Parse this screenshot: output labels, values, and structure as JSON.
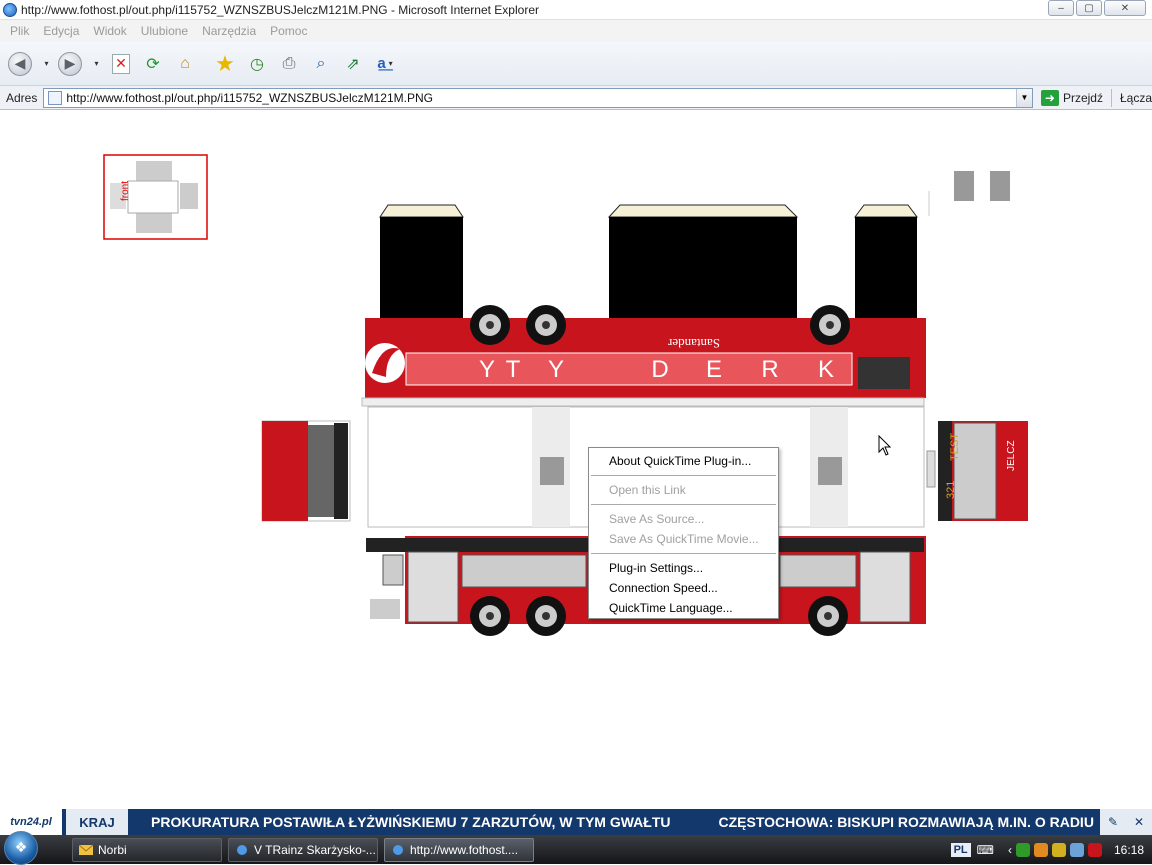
{
  "window": {
    "title": "http://www.fothost.pl/out.php/i115752_WZNSZBUSJelczM121M.PNG - Microsoft Internet Explorer",
    "minimize_label": "‒",
    "maximize_label": "▢",
    "close_label": "✕"
  },
  "menu": {
    "items": [
      "Plik",
      "Edycja",
      "Widok",
      "Ulubione",
      "Narzędzia",
      "Pomoc"
    ]
  },
  "toolbar": {
    "back_glyph": "◀",
    "forward_glyph": "▶",
    "drop_glyph": "▾"
  },
  "address": {
    "label": "Adres",
    "url": "http://www.fothost.pl/out.php/i115752_WZNSZBUSJelczM121M.PNG",
    "go_label": "Przejdź",
    "links_label": "Łącza"
  },
  "content": {
    "thumb_label": "front",
    "bus_brand": "KREDYTY",
    "bank_name": "Santander",
    "line_number": "321",
    "route_test": "TEST",
    "model": "JELCZ"
  },
  "context_menu": {
    "items": [
      {
        "label": "About QuickTime Plug-in...",
        "enabled": true
      },
      {
        "label": "Open this Link",
        "enabled": false
      },
      {
        "label": "Save As Source...",
        "enabled": false
      },
      {
        "label": "Save As QuickTime Movie...",
        "enabled": false
      },
      {
        "label": "Plug-in Settings...",
        "enabled": true
      },
      {
        "label": "Connection Speed...",
        "enabled": true
      },
      {
        "label": "QuickTime Language...",
        "enabled": true
      }
    ]
  },
  "ticker": {
    "logo": "tvn24.pl",
    "category": "KRAJ",
    "headline_1": "PROKURATURA POSTAWIŁA ŁYŻWIŃSKIEMU 7 ZARZUTÓW, W TYM GWAŁTU",
    "headline_2": "CZĘSTOCHOWA: BISKUPI ROZMAWIAJĄ M.IN. O RADIU"
  },
  "taskbar": {
    "tasks": [
      {
        "label": "Norbi",
        "active": false
      },
      {
        "label": "V TRainz Skarżysko-...",
        "active": false
      },
      {
        "label": "http://www.fothost....",
        "active": true
      }
    ],
    "language": "PL",
    "clock": "16:18"
  },
  "colors": {
    "bus_red": "#c8141c",
    "ticker_blue": "#13386b"
  }
}
